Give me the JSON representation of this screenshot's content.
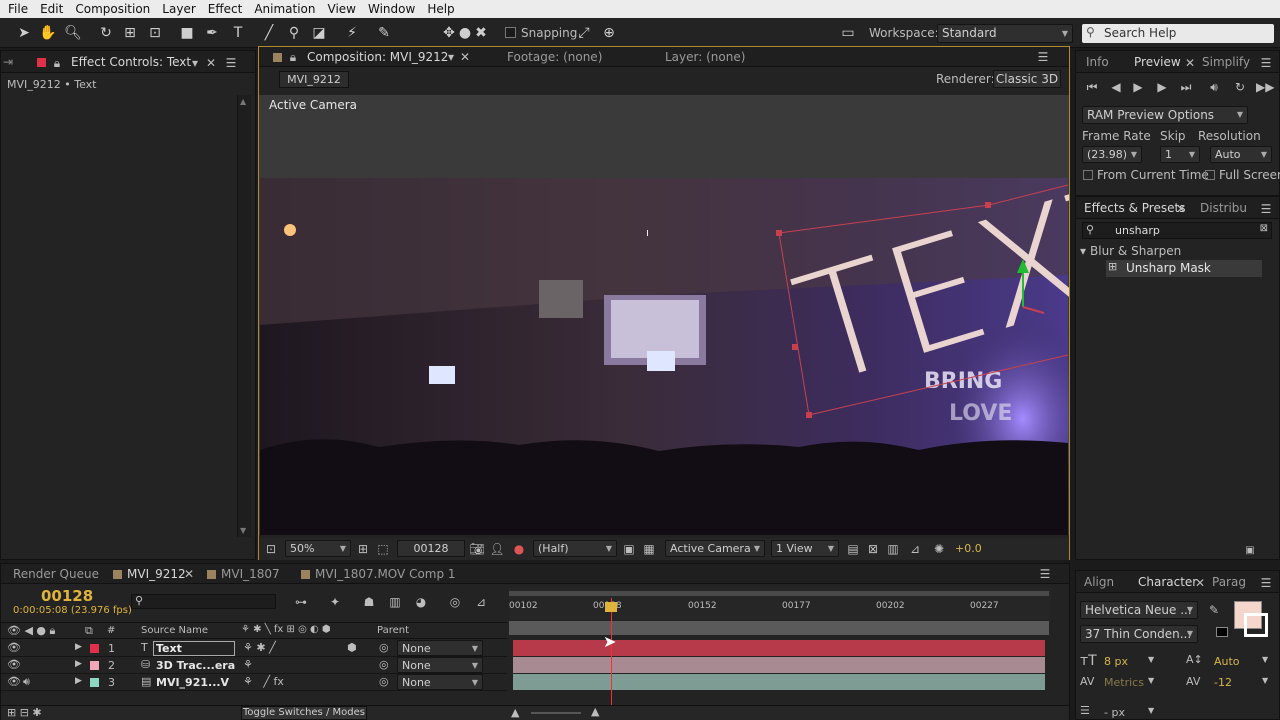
{
  "menu": [
    "File",
    "Edit",
    "Composition",
    "Layer",
    "Effect",
    "Animation",
    "View",
    "Window",
    "Help"
  ],
  "toolbar": {
    "snapping": "Snapping",
    "workspace_label": "Workspace:",
    "workspace_value": "Standard",
    "search_placeholder": "Search Help"
  },
  "left_panel": {
    "tab": "Effect Controls: Text",
    "subtitle": "MVI_9212 • Text"
  },
  "comp": {
    "tab": "Composition: MVI_9212",
    "footage_tab": "Footage: (none)",
    "layer_tab": "Layer: (none)",
    "breadcrumb": "MVI_9212",
    "renderer_label": "Renderer:",
    "renderer_value": "Classic 3D",
    "view_label": "Active Camera",
    "overlay_text": "TEXT",
    "stage_text_1": "BRING",
    "stage_text_2": "LOVE",
    "footer": {
      "zoom": "50%",
      "timecode": "00128",
      "resolution": "(Half)",
      "camera": "Active Camera",
      "views": "1 View",
      "exposure": "+0.0"
    }
  },
  "preview": {
    "tabs": [
      "Info",
      "Preview",
      "Simplify"
    ],
    "ram_options": "RAM Preview Options",
    "frame_rate_label": "Frame Rate",
    "skip_label": "Skip",
    "resolution_label": "Resolution",
    "frame_rate": "(23.98)",
    "skip": "1",
    "resolution": "Auto",
    "from_current": "From Current Time",
    "full_screen": "Full Screen"
  },
  "effects": {
    "tab": "Effects & Presets",
    "tab2": "Distribu",
    "search": "unsharp",
    "category": "Blur & Sharpen",
    "item": "Unsharp Mask"
  },
  "timeline": {
    "tabs": [
      "Render Queue",
      "MVI_9212",
      "MVI_1807",
      "MVI_1807.MOV Comp 1"
    ],
    "current_time": "00128",
    "time_sub": "0:00:05:08 (23.976 fps)",
    "col_source": "Source Name",
    "col_parent": "Parent",
    "col_num": "#",
    "ticks": [
      "00102",
      "00128",
      "00152",
      "00177",
      "00202",
      "00227"
    ],
    "layers": [
      {
        "num": "1",
        "name": "Text",
        "parent": "None",
        "color": "#e0314b",
        "bar": "#b63a4a"
      },
      {
        "num": "2",
        "name": "3D Trac...era",
        "parent": "None",
        "color": "#f0a8b8",
        "bar": "#a88a92"
      },
      {
        "num": "3",
        "name": "MVI_921...V",
        "parent": "None",
        "color": "#8ed6c4",
        "bar": "#7e9c94"
      }
    ],
    "toggle": "Toggle Switches / Modes"
  },
  "character": {
    "tabs": [
      "Align",
      "Character",
      "Parag"
    ],
    "font": "Helvetica Neue ...",
    "style": "37 Thin Conden...",
    "size": "8 px",
    "leading": "Auto",
    "kerning": "Metrics",
    "tracking": "-12",
    "stroke": "- px"
  }
}
